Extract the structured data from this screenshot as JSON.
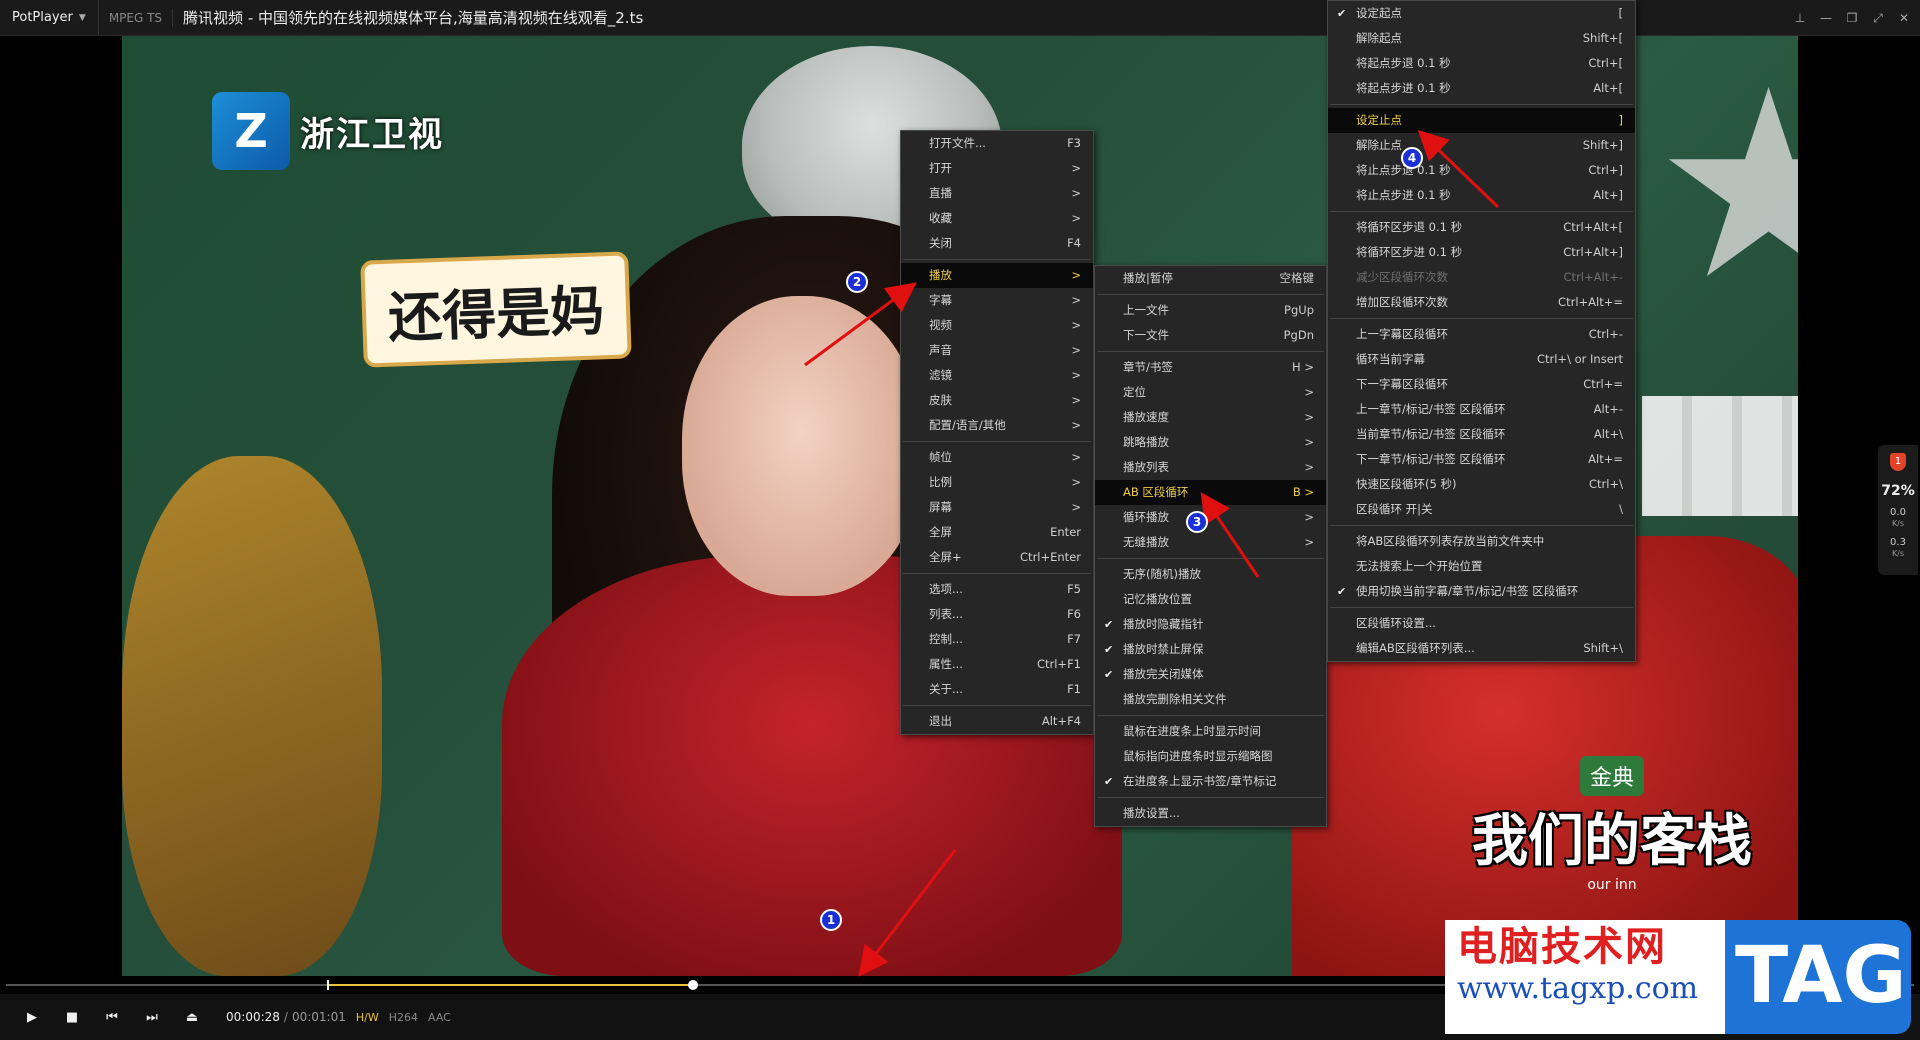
{
  "titlebar": {
    "app_name": "PotPlayer",
    "format": "MPEG TS",
    "file_title": "腾讯视频 - 中国领先的在线视频媒体平台,海量高清视频在线观看_2.ts"
  },
  "video": {
    "channel_name": "浙江卫视",
    "caption": "还得是妈",
    "show_brand": "金典",
    "show_name": "我们的客栈",
    "show_sub": "our inn"
  },
  "playback": {
    "current_time": "00:00:28",
    "total_time": "00:01:01",
    "hw": "H/W",
    "video_codec": "H264",
    "audio_codec": "AAC",
    "progress": 0.36,
    "ab_start": 0.168
  },
  "side_widget": {
    "badge": "1",
    "percent": "72%",
    "up_rate": "0.0",
    "down_rate": "0.3",
    "unit": "K/s"
  },
  "main_menu": [
    {
      "label": "打开文件...",
      "shortcut": "F3"
    },
    {
      "label": "打开",
      "shortcut": ">"
    },
    {
      "label": "直播",
      "shortcut": ">"
    },
    {
      "label": "收藏",
      "shortcut": ">"
    },
    {
      "label": "关闭",
      "shortcut": "F4"
    },
    {
      "sep": true
    },
    {
      "label": "播放",
      "shortcut": ">",
      "active": true
    },
    {
      "label": "字幕",
      "shortcut": ">"
    },
    {
      "label": "视频",
      "shortcut": ">"
    },
    {
      "label": "声音",
      "shortcut": ">"
    },
    {
      "label": "滤镜",
      "shortcut": ">"
    },
    {
      "label": "皮肤",
      "shortcut": ">"
    },
    {
      "label": "配置/语言/其他",
      "shortcut": ">"
    },
    {
      "sep": true
    },
    {
      "label": "帧位",
      "shortcut": ">"
    },
    {
      "label": "比例",
      "shortcut": ">"
    },
    {
      "label": "屏幕",
      "shortcut": ">"
    },
    {
      "label": "全屏",
      "shortcut": "Enter"
    },
    {
      "label": "全屏+",
      "shortcut": "Ctrl+Enter"
    },
    {
      "sep": true
    },
    {
      "label": "选项...",
      "shortcut": "F5"
    },
    {
      "label": "列表...",
      "shortcut": "F6"
    },
    {
      "label": "控制...",
      "shortcut": "F7"
    },
    {
      "label": "属性...",
      "shortcut": "Ctrl+F1"
    },
    {
      "label": "关于...",
      "shortcut": "F1"
    },
    {
      "sep": true
    },
    {
      "label": "退出",
      "shortcut": "Alt+F4"
    }
  ],
  "play_menu": [
    {
      "label": "播放|暂停",
      "shortcut": "空格键"
    },
    {
      "sep": true
    },
    {
      "label": "上一文件",
      "shortcut": "PgUp"
    },
    {
      "label": "下一文件",
      "shortcut": "PgDn"
    },
    {
      "sep": true
    },
    {
      "label": "章节/书签",
      "shortcut": "H >"
    },
    {
      "label": "定位",
      "shortcut": ">"
    },
    {
      "label": "播放速度",
      "shortcut": ">"
    },
    {
      "label": "跳略播放",
      "shortcut": ">"
    },
    {
      "label": "播放列表",
      "shortcut": ">"
    },
    {
      "label": "AB 区段循环",
      "shortcut": "B >",
      "active": true
    },
    {
      "label": "循环播放",
      "shortcut": ">"
    },
    {
      "label": "无缝播放",
      "shortcut": ">"
    },
    {
      "sep": true
    },
    {
      "label": "无序(随机)播放",
      "shortcut": ""
    },
    {
      "label": "记忆播放位置",
      "shortcut": ""
    },
    {
      "label": "播放时隐藏指针",
      "shortcut": "",
      "checked": true
    },
    {
      "label": "播放时禁止屏保",
      "shortcut": "",
      "checked": true
    },
    {
      "label": "播放完关闭媒体",
      "shortcut": "",
      "checked": true
    },
    {
      "label": "播放完删除相关文件",
      "shortcut": ""
    },
    {
      "sep": true
    },
    {
      "label": "鼠标在进度条上时显示时间",
      "shortcut": ""
    },
    {
      "label": "鼠标指向进度条时显示缩略图",
      "shortcut": ""
    },
    {
      "label": "在进度条上显示书签/章节标记",
      "shortcut": "",
      "checked": true
    },
    {
      "sep": true
    },
    {
      "label": "播放设置...",
      "shortcut": ""
    }
  ],
  "ab_menu": [
    {
      "label": "设定起点",
      "shortcut": "[",
      "checked": true
    },
    {
      "label": "解除起点",
      "shortcut": "Shift+["
    },
    {
      "label": "将起点步退 0.1 秒",
      "shortcut": "Ctrl+["
    },
    {
      "label": "将起点步进 0.1 秒",
      "shortcut": "Alt+["
    },
    {
      "sep": true
    },
    {
      "label": "设定止点",
      "shortcut": "]",
      "active": true
    },
    {
      "label": "解除止点",
      "shortcut": "Shift+]"
    },
    {
      "label": "将止点步退 0.1 秒",
      "shortcut": "Ctrl+]"
    },
    {
      "label": "将止点步进 0.1 秒",
      "shortcut": "Alt+]"
    },
    {
      "sep": true
    },
    {
      "label": "将循环区步退 0.1 秒",
      "shortcut": "Ctrl+Alt+["
    },
    {
      "label": "将循环区步进 0.1 秒",
      "shortcut": "Ctrl+Alt+]"
    },
    {
      "label": "减少区段循环次数",
      "shortcut": "Ctrl+Alt+-",
      "disabled": true
    },
    {
      "label": "增加区段循环次数",
      "shortcut": "Ctrl+Alt+="
    },
    {
      "sep": true
    },
    {
      "label": "上一字幕区段循环",
      "shortcut": "Ctrl+-"
    },
    {
      "label": "循环当前字幕",
      "shortcut": "Ctrl+\\ or Insert"
    },
    {
      "label": "下一字幕区段循环",
      "shortcut": "Ctrl+="
    },
    {
      "label": "上一章节/标记/书签 区段循环",
      "shortcut": "Alt+-"
    },
    {
      "label": "当前章节/标记/书签 区段循环",
      "shortcut": "Alt+\\"
    },
    {
      "label": "下一章节/标记/书签 区段循环",
      "shortcut": "Alt+="
    },
    {
      "label": "快速区段循环(5 秒)",
      "shortcut": "Ctrl+\\"
    },
    {
      "label": "区段循环 开|关",
      "shortcut": "\\"
    },
    {
      "sep": true
    },
    {
      "label": "将AB区段循环列表存放当前文件夹中",
      "shortcut": ""
    },
    {
      "label": "无法搜索上一个开始位置",
      "shortcut": ""
    },
    {
      "label": "使用切换当前字幕/章节/标记/书签 区段循环",
      "shortcut": "",
      "checked": true
    },
    {
      "sep": true
    },
    {
      "label": "区段循环设置...",
      "shortcut": ""
    },
    {
      "label": "编辑AB区段循环列表...",
      "shortcut": "Shift+\\"
    }
  ],
  "annotations": [
    "1",
    "2",
    "3",
    "4"
  ],
  "watermark": {
    "title": "电脑技术网",
    "url": "www.tagxp.com",
    "tag": "TAG"
  },
  "colors": {
    "accent": "#f0cf45",
    "seek_fill": "#e8c23a",
    "annotation_arrow": "#e01010",
    "badge": "#1a2fd6"
  },
  "icons": {
    "play": "play-icon",
    "stop": "stop-icon",
    "prev": "previous-icon",
    "next": "next-icon",
    "eject": "eject-icon"
  }
}
